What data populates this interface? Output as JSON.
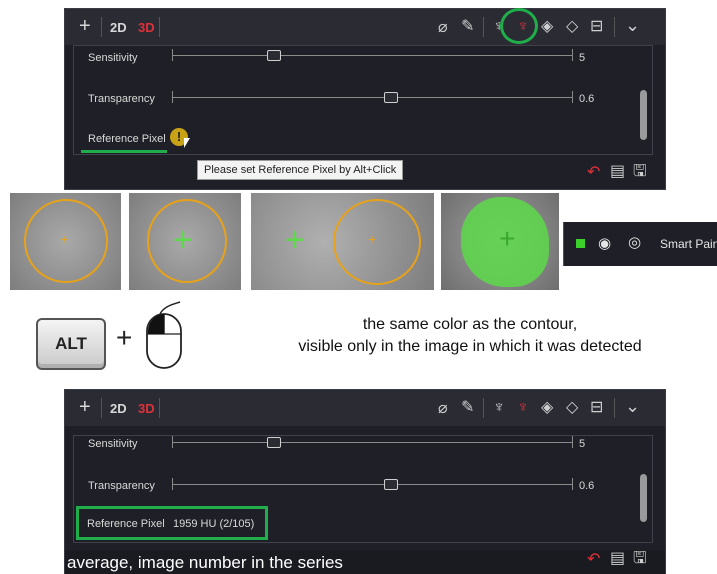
{
  "panel1": {
    "toolbar": {
      "plus": "+",
      "mode_2d": "2D",
      "mode_3d": "3D"
    },
    "sensitivity": {
      "label": "Sensitivity",
      "value": "5"
    },
    "transparency": {
      "label": "Transparency",
      "value": "0.6"
    },
    "reference_pixel": {
      "label": "Reference Pixel",
      "warning": "!"
    },
    "tooltip": "Please set Reference Pixel by Alt+Click"
  },
  "images_row": {
    "layer_label": "Smart Paint",
    "colors": {
      "contour": "#e8a21a",
      "fill": "#5dd94a",
      "square": "#3bd12a"
    }
  },
  "alt_instruction": {
    "key": "ALT",
    "plus": "+",
    "caption_line1": "the same color as the contour,",
    "caption_line2": "visible only in the image in which it was detected"
  },
  "panel2": {
    "toolbar": {
      "plus": "+",
      "mode_2d": "2D",
      "mode_3d": "3D"
    },
    "sensitivity": {
      "label": "Sensitivity",
      "value": "5"
    },
    "transparency": {
      "label": "Transparency",
      "value": "0.6"
    },
    "reference_pixel": {
      "label": "Reference Pixel",
      "value": "1959 HU (2/105)"
    },
    "caption": "average, image number in the series"
  },
  "icons": [
    "eraser-icon",
    "pencil-icon",
    "brush-icon",
    "smart-brush-icon",
    "fill-icon",
    "bucket-icon",
    "layers-icon",
    "chevron-down-icon",
    "undo-icon",
    "csv-export-icon",
    "save-icon",
    "eye-icon",
    "location-icon",
    "mouse-icon"
  ],
  "accent": {
    "highlight_green": "#1fae4a",
    "active_red": "#e0303a",
    "panel_bg": "#1f2027"
  }
}
